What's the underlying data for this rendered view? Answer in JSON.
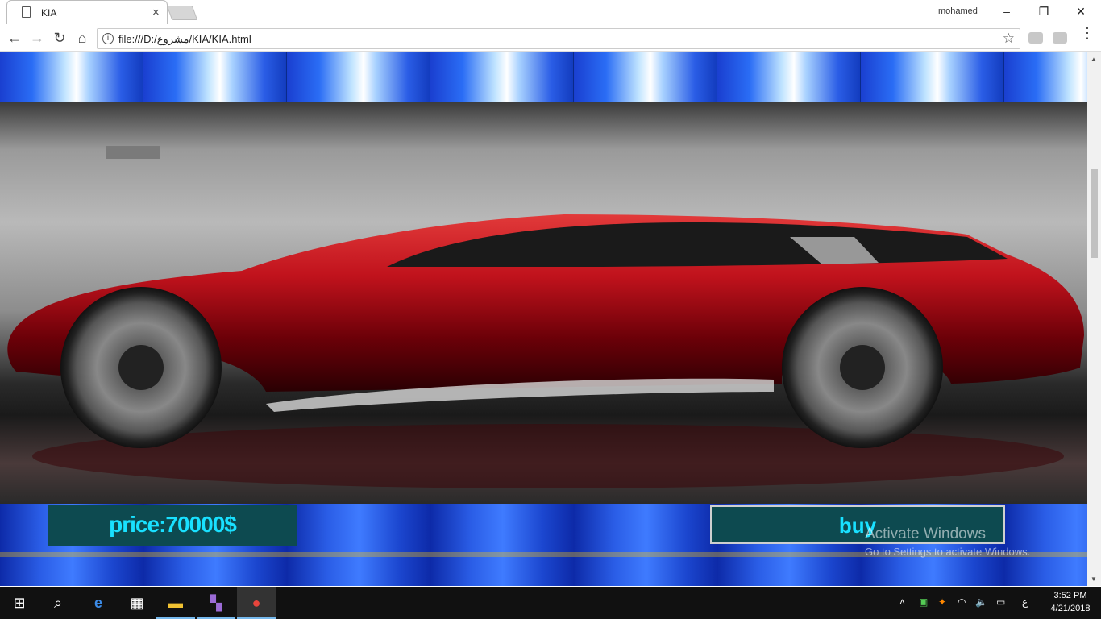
{
  "browser": {
    "tab_title": "KIA",
    "tab_close": "×",
    "user_name": "mohamed",
    "window_minimize": "–",
    "window_restore": "❐",
    "window_close": "✕",
    "url": "file:///D:/مشروع/KIA/KIA.html"
  },
  "page": {
    "price_label": "price:70000$",
    "buy_label": "buy"
  },
  "watermark": {
    "line1": "Activate Windows",
    "line2": "Go to Settings to activate Windows."
  },
  "taskbar": {
    "language": "ع",
    "time": "3:52 PM",
    "date": "4/21/2018"
  },
  "colors": {
    "button_bg": "#0d4a50",
    "button_text": "#19e0ff",
    "car_red": "#b0101a"
  }
}
